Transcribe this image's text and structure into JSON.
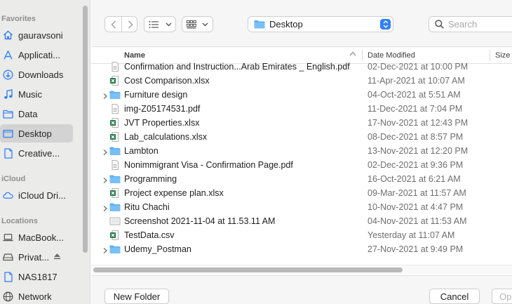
{
  "sidebar": {
    "favorites_label": "Favorites",
    "favorites": [
      {
        "label": "gauravsoni",
        "icon": "home-icon"
      },
      {
        "label": "Applicati...",
        "icon": "applications-icon"
      },
      {
        "label": "Downloads",
        "icon": "downloads-icon"
      },
      {
        "label": "Music",
        "icon": "music-icon"
      },
      {
        "label": "Data",
        "icon": "folder-icon"
      },
      {
        "label": "Desktop",
        "icon": "desktop-icon",
        "selected": true
      },
      {
        "label": "Creative...",
        "icon": "document-icon"
      }
    ],
    "icloud_label": "iCloud",
    "icloud": [
      {
        "label": "iCloud Dri...",
        "icon": "cloud-icon"
      }
    ],
    "locations_label": "Locations",
    "locations": [
      {
        "label": "MacBook...",
        "icon": "laptop-icon"
      },
      {
        "label": "Privat...",
        "icon": "drive-icon"
      },
      {
        "label": "NAS1817",
        "icon": "document-icon"
      },
      {
        "label": "Network",
        "icon": "network-icon"
      }
    ]
  },
  "toolbar": {
    "location": "Desktop",
    "search_placeholder": "Search"
  },
  "columns": {
    "name": "Name",
    "date": "Date Modified",
    "size": "Size"
  },
  "files": [
    {
      "name": "Confirmation and Instruction...Arab Emirates _ English.pdf",
      "date": "02-Dec-2021 at 10:00 PM",
      "kind": "pdf"
    },
    {
      "name": "Cost Comparison.xlsx",
      "date": "11-Apr-2021 at 10:07 AM",
      "kind": "xlsx"
    },
    {
      "name": "Furniture design",
      "date": "04-Oct-2021 at 5:51 AM",
      "kind": "folder"
    },
    {
      "name": "img-Z05174531.pdf",
      "date": "11-Dec-2021 at 7:04 PM",
      "kind": "pdf"
    },
    {
      "name": "JVT Properties.xlsx",
      "date": "17-Nov-2021 at 12:43 PM",
      "kind": "xlsx"
    },
    {
      "name": "Lab_calculations.xlsx",
      "date": "08-Dec-2021 at 8:57 PM",
      "kind": "xlsx"
    },
    {
      "name": "Lambton",
      "date": "13-Nov-2021 at 12:20 PM",
      "kind": "folder"
    },
    {
      "name": "Nonimmigrant Visa - Confirmation Page.pdf",
      "date": "02-Dec-2021 at 9:36 PM",
      "kind": "pdf"
    },
    {
      "name": "Programming",
      "date": "16-Oct-2021 at 6:21 AM",
      "kind": "folder"
    },
    {
      "name": "Project expense plan.xlsx",
      "date": "09-Mar-2021 at 11:57 AM",
      "kind": "xlsx"
    },
    {
      "name": "Ritu Chachi",
      "date": "10-Nov-2021 at 4:47 PM",
      "kind": "folder"
    },
    {
      "name": "Screenshot 2021-11-04 at 11.53.11 AM",
      "date": "04-Nov-2021 at 11:53 AM",
      "kind": "image"
    },
    {
      "name": "TestData.csv",
      "date": "Yesterday at 11:07 AM",
      "kind": "xlsx"
    },
    {
      "name": "Udemy_Postman",
      "date": "27-Nov-2021 at 9:49 PM",
      "kind": "folder"
    }
  ],
  "buttons": {
    "new_folder": "New Folder",
    "cancel": "Cancel",
    "open": "Op"
  },
  "colors": {
    "accent": "#2f7ff6",
    "folder": "#5ab0f3",
    "excel": "#1f7a42"
  }
}
